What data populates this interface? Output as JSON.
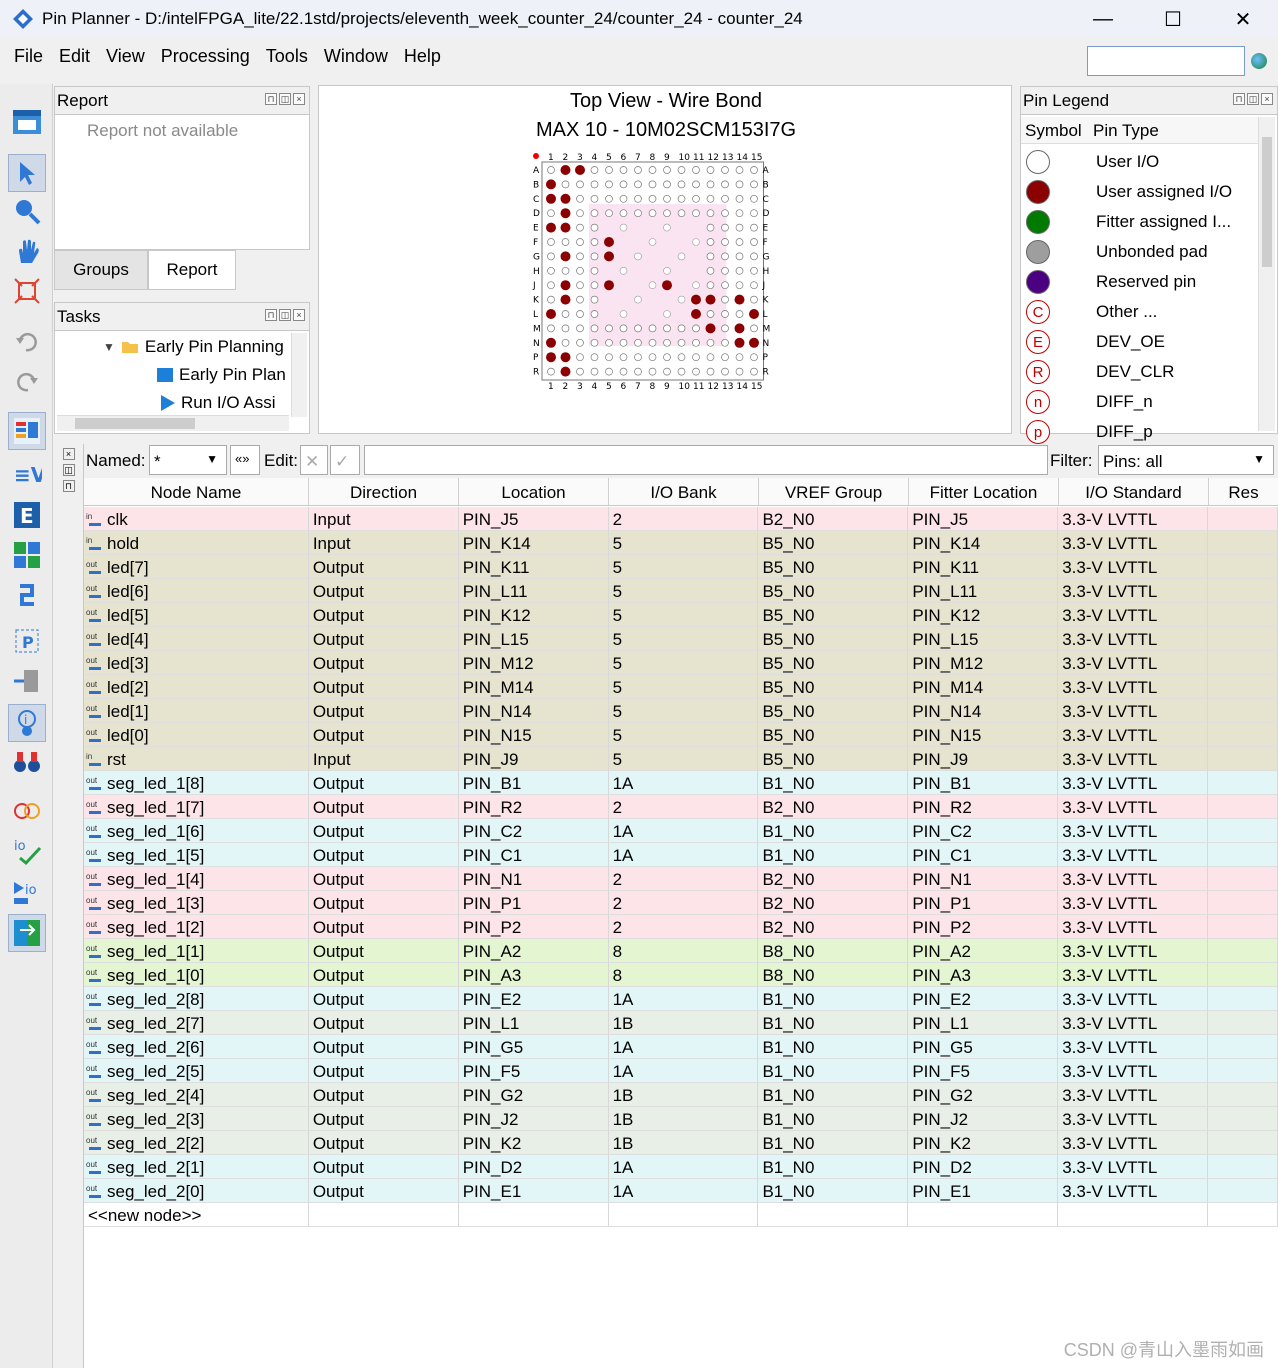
{
  "window": {
    "title": "Pin Planner - D:/intelFPGA_lite/22.1std/projects/eleventh_week_counter_24/counter_24 - counter_24",
    "minimize": "—",
    "maximize": "☐",
    "close": "✕"
  },
  "menu": [
    "File",
    "Edit",
    "View",
    "Processing",
    "Tools",
    "Window",
    "Help"
  ],
  "report_panel": {
    "title": "Report",
    "message": "Report not available"
  },
  "bottom_tabs": [
    "Groups",
    "Report"
  ],
  "tasks_panel": {
    "title": "Tasks",
    "items": [
      "Early Pin Planning",
      "Early Pin Plan",
      "Run I/O Assi"
    ]
  },
  "chip_view": {
    "title": "Top View - Wire Bond",
    "subtitle": "MAX 10 - 10M02SCM153I7G",
    "columns": [
      "1",
      "2",
      "3",
      "4",
      "5",
      "6",
      "7",
      "8",
      "9",
      "10",
      "11",
      "12",
      "13",
      "14",
      "15"
    ],
    "rows": [
      "A",
      "B",
      "C",
      "D",
      "E",
      "F",
      "G",
      "H",
      "J",
      "K",
      "L",
      "M",
      "N",
      "P",
      "R"
    ]
  },
  "legend_panel": {
    "title": "Pin Legend",
    "col_symbol": "Symbol",
    "col_type": "Pin Type",
    "items": [
      {
        "label": "User I/O",
        "color": "#ffffff",
        "glyph": ""
      },
      {
        "label": "User assigned I/O",
        "color": "#8b0000",
        "glyph": ""
      },
      {
        "label": "Fitter assigned I...",
        "color": "#007a00",
        "glyph": ""
      },
      {
        "label": "Unbonded pad",
        "color": "#9e9e9e",
        "glyph": ""
      },
      {
        "label": "Reserved pin",
        "color": "#4b0082",
        "glyph": ""
      },
      {
        "label": "Other ...",
        "color": "#ffffff",
        "glyph": "C"
      },
      {
        "label": "DEV_OE",
        "color": "#ffffff",
        "glyph": "E"
      },
      {
        "label": "DEV_CLR",
        "color": "#ffffff",
        "glyph": "R"
      },
      {
        "label": "DIFF_n",
        "color": "#ffffff",
        "glyph": "n"
      },
      {
        "label": "DIFF_p",
        "color": "#ffffff",
        "glyph": "p"
      }
    ]
  },
  "filter_bar": {
    "named_label": "Named:",
    "named_value": "*",
    "edit_label": "Edit:",
    "filter_label": "Filter:",
    "filter_value": "Pins: all"
  },
  "table": {
    "headers": [
      "Node Name",
      "Direction",
      "Location",
      "I/O Bank",
      "VREF Group",
      "Fitter Location",
      "I/O Standard",
      "Res"
    ],
    "rows": [
      {
        "name": "clk",
        "dir": "Input",
        "loc": "PIN_J5",
        "bank": "2",
        "vref": "B2_N0",
        "fit": "PIN_J5",
        "std": "3.3-V LVTTL",
        "bg": "#fce4e8"
      },
      {
        "name": "hold",
        "dir": "Input",
        "loc": "PIN_K14",
        "bank": "5",
        "vref": "B5_N0",
        "fit": "PIN_K14",
        "std": "3.3-V LVTTL",
        "bg": "#e6e4cf"
      },
      {
        "name": "led[7]",
        "dir": "Output",
        "loc": "PIN_K11",
        "bank": "5",
        "vref": "B5_N0",
        "fit": "PIN_K11",
        "std": "3.3-V LVTTL",
        "bg": "#e6e4cf"
      },
      {
        "name": "led[6]",
        "dir": "Output",
        "loc": "PIN_L11",
        "bank": "5",
        "vref": "B5_N0",
        "fit": "PIN_L11",
        "std": "3.3-V LVTTL",
        "bg": "#e6e4cf"
      },
      {
        "name": "led[5]",
        "dir": "Output",
        "loc": "PIN_K12",
        "bank": "5",
        "vref": "B5_N0",
        "fit": "PIN_K12",
        "std": "3.3-V LVTTL",
        "bg": "#e6e4cf"
      },
      {
        "name": "led[4]",
        "dir": "Output",
        "loc": "PIN_L15",
        "bank": "5",
        "vref": "B5_N0",
        "fit": "PIN_L15",
        "std": "3.3-V LVTTL",
        "bg": "#e6e4cf"
      },
      {
        "name": "led[3]",
        "dir": "Output",
        "loc": "PIN_M12",
        "bank": "5",
        "vref": "B5_N0",
        "fit": "PIN_M12",
        "std": "3.3-V LVTTL",
        "bg": "#e6e4cf"
      },
      {
        "name": "led[2]",
        "dir": "Output",
        "loc": "PIN_M14",
        "bank": "5",
        "vref": "B5_N0",
        "fit": "PIN_M14",
        "std": "3.3-V LVTTL",
        "bg": "#e6e4cf"
      },
      {
        "name": "led[1]",
        "dir": "Output",
        "loc": "PIN_N14",
        "bank": "5",
        "vref": "B5_N0",
        "fit": "PIN_N14",
        "std": "3.3-V LVTTL",
        "bg": "#e6e4cf"
      },
      {
        "name": "led[0]",
        "dir": "Output",
        "loc": "PIN_N15",
        "bank": "5",
        "vref": "B5_N0",
        "fit": "PIN_N15",
        "std": "3.3-V LVTTL",
        "bg": "#e6e4cf"
      },
      {
        "name": "rst",
        "dir": "Input",
        "loc": "PIN_J9",
        "bank": "5",
        "vref": "B5_N0",
        "fit": "PIN_J9",
        "std": "3.3-V LVTTL",
        "bg": "#e6e4cf"
      },
      {
        "name": "seg_led_1[8]",
        "dir": "Output",
        "loc": "PIN_B1",
        "bank": "1A",
        "vref": "B1_N0",
        "fit": "PIN_B1",
        "std": "3.3-V LVTTL",
        "bg": "#e2f6f8"
      },
      {
        "name": "seg_led_1[7]",
        "dir": "Output",
        "loc": "PIN_R2",
        "bank": "2",
        "vref": "B2_N0",
        "fit": "PIN_R2",
        "std": "3.3-V LVTTL",
        "bg": "#fce4e8"
      },
      {
        "name": "seg_led_1[6]",
        "dir": "Output",
        "loc": "PIN_C2",
        "bank": "1A",
        "vref": "B1_N0",
        "fit": "PIN_C2",
        "std": "3.3-V LVTTL",
        "bg": "#e2f6f8"
      },
      {
        "name": "seg_led_1[5]",
        "dir": "Output",
        "loc": "PIN_C1",
        "bank": "1A",
        "vref": "B1_N0",
        "fit": "PIN_C1",
        "std": "3.3-V LVTTL",
        "bg": "#e2f6f8"
      },
      {
        "name": "seg_led_1[4]",
        "dir": "Output",
        "loc": "PIN_N1",
        "bank": "2",
        "vref": "B2_N0",
        "fit": "PIN_N1",
        "std": "3.3-V LVTTL",
        "bg": "#fce4e8"
      },
      {
        "name": "seg_led_1[3]",
        "dir": "Output",
        "loc": "PIN_P1",
        "bank": "2",
        "vref": "B2_N0",
        "fit": "PIN_P1",
        "std": "3.3-V LVTTL",
        "bg": "#fce4e8"
      },
      {
        "name": "seg_led_1[2]",
        "dir": "Output",
        "loc": "PIN_P2",
        "bank": "2",
        "vref": "B2_N0",
        "fit": "PIN_P2",
        "std": "3.3-V LVTTL",
        "bg": "#fce4e8"
      },
      {
        "name": "seg_led_1[1]",
        "dir": "Output",
        "loc": "PIN_A2",
        "bank": "8",
        "vref": "B8_N0",
        "fit": "PIN_A2",
        "std": "3.3-V LVTTL",
        "bg": "#e4f5d2"
      },
      {
        "name": "seg_led_1[0]",
        "dir": "Output",
        "loc": "PIN_A3",
        "bank": "8",
        "vref": "B8_N0",
        "fit": "PIN_A3",
        "std": "3.3-V LVTTL",
        "bg": "#e4f5d2"
      },
      {
        "name": "seg_led_2[8]",
        "dir": "Output",
        "loc": "PIN_E2",
        "bank": "1A",
        "vref": "B1_N0",
        "fit": "PIN_E2",
        "std": "3.3-V LVTTL",
        "bg": "#e2f6f8"
      },
      {
        "name": "seg_led_2[7]",
        "dir": "Output",
        "loc": "PIN_L1",
        "bank": "1B",
        "vref": "B1_N0",
        "fit": "PIN_L1",
        "std": "3.3-V LVTTL",
        "bg": "#e8efe6"
      },
      {
        "name": "seg_led_2[6]",
        "dir": "Output",
        "loc": "PIN_G5",
        "bank": "1A",
        "vref": "B1_N0",
        "fit": "PIN_G5",
        "std": "3.3-V LVTTL",
        "bg": "#e2f6f8"
      },
      {
        "name": "seg_led_2[5]",
        "dir": "Output",
        "loc": "PIN_F5",
        "bank": "1A",
        "vref": "B1_N0",
        "fit": "PIN_F5",
        "std": "3.3-V LVTTL",
        "bg": "#e2f6f8"
      },
      {
        "name": "seg_led_2[4]",
        "dir": "Output",
        "loc": "PIN_G2",
        "bank": "1B",
        "vref": "B1_N0",
        "fit": "PIN_G2",
        "std": "3.3-V LVTTL",
        "bg": "#e8efe6"
      },
      {
        "name": "seg_led_2[3]",
        "dir": "Output",
        "loc": "PIN_J2",
        "bank": "1B",
        "vref": "B1_N0",
        "fit": "PIN_J2",
        "std": "3.3-V LVTTL",
        "bg": "#e8efe6"
      },
      {
        "name": "seg_led_2[2]",
        "dir": "Output",
        "loc": "PIN_K2",
        "bank": "1B",
        "vref": "B1_N0",
        "fit": "PIN_K2",
        "std": "3.3-V LVTTL",
        "bg": "#e8efe6"
      },
      {
        "name": "seg_led_2[1]",
        "dir": "Output",
        "loc": "PIN_D2",
        "bank": "1A",
        "vref": "B1_N0",
        "fit": "PIN_D2",
        "std": "3.3-V LVTTL",
        "bg": "#e2f6f8"
      },
      {
        "name": "seg_led_2[0]",
        "dir": "Output",
        "loc": "PIN_E1",
        "bank": "1A",
        "vref": "B1_N0",
        "fit": "PIN_E1",
        "std": "3.3-V LVTTL",
        "bg": "#e2f6f8"
      }
    ],
    "new_node": "<<new node>>"
  },
  "watermark": "CSDN @青山入墨雨如画"
}
